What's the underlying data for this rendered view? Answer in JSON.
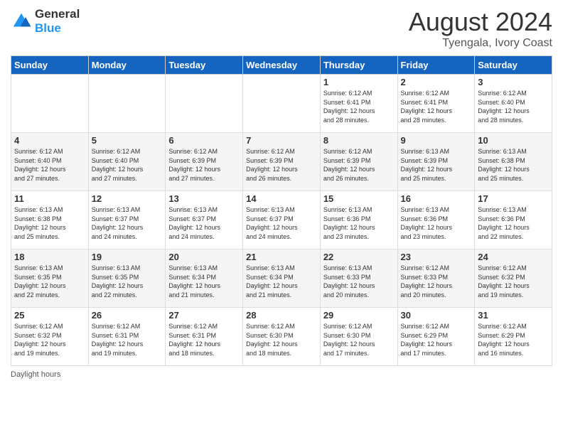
{
  "header": {
    "logo_general": "General",
    "logo_blue": "Blue",
    "title": "August 2024",
    "location": "Tyengala, Ivory Coast"
  },
  "weekdays": [
    "Sunday",
    "Monday",
    "Tuesday",
    "Wednesday",
    "Thursday",
    "Friday",
    "Saturday"
  ],
  "weeks": [
    [
      {
        "day": "",
        "info": ""
      },
      {
        "day": "",
        "info": ""
      },
      {
        "day": "",
        "info": ""
      },
      {
        "day": "",
        "info": ""
      },
      {
        "day": "1",
        "info": "Sunrise: 6:12 AM\nSunset: 6:41 PM\nDaylight: 12 hours\nand 28 minutes."
      },
      {
        "day": "2",
        "info": "Sunrise: 6:12 AM\nSunset: 6:41 PM\nDaylight: 12 hours\nand 28 minutes."
      },
      {
        "day": "3",
        "info": "Sunrise: 6:12 AM\nSunset: 6:40 PM\nDaylight: 12 hours\nand 28 minutes."
      }
    ],
    [
      {
        "day": "4",
        "info": "Sunrise: 6:12 AM\nSunset: 6:40 PM\nDaylight: 12 hours\nand 27 minutes."
      },
      {
        "day": "5",
        "info": "Sunrise: 6:12 AM\nSunset: 6:40 PM\nDaylight: 12 hours\nand 27 minutes."
      },
      {
        "day": "6",
        "info": "Sunrise: 6:12 AM\nSunset: 6:39 PM\nDaylight: 12 hours\nand 27 minutes."
      },
      {
        "day": "7",
        "info": "Sunrise: 6:12 AM\nSunset: 6:39 PM\nDaylight: 12 hours\nand 26 minutes."
      },
      {
        "day": "8",
        "info": "Sunrise: 6:12 AM\nSunset: 6:39 PM\nDaylight: 12 hours\nand 26 minutes."
      },
      {
        "day": "9",
        "info": "Sunrise: 6:13 AM\nSunset: 6:39 PM\nDaylight: 12 hours\nand 25 minutes."
      },
      {
        "day": "10",
        "info": "Sunrise: 6:13 AM\nSunset: 6:38 PM\nDaylight: 12 hours\nand 25 minutes."
      }
    ],
    [
      {
        "day": "11",
        "info": "Sunrise: 6:13 AM\nSunset: 6:38 PM\nDaylight: 12 hours\nand 25 minutes."
      },
      {
        "day": "12",
        "info": "Sunrise: 6:13 AM\nSunset: 6:37 PM\nDaylight: 12 hours\nand 24 minutes."
      },
      {
        "day": "13",
        "info": "Sunrise: 6:13 AM\nSunset: 6:37 PM\nDaylight: 12 hours\nand 24 minutes."
      },
      {
        "day": "14",
        "info": "Sunrise: 6:13 AM\nSunset: 6:37 PM\nDaylight: 12 hours\nand 24 minutes."
      },
      {
        "day": "15",
        "info": "Sunrise: 6:13 AM\nSunset: 6:36 PM\nDaylight: 12 hours\nand 23 minutes."
      },
      {
        "day": "16",
        "info": "Sunrise: 6:13 AM\nSunset: 6:36 PM\nDaylight: 12 hours\nand 23 minutes."
      },
      {
        "day": "17",
        "info": "Sunrise: 6:13 AM\nSunset: 6:36 PM\nDaylight: 12 hours\nand 22 minutes."
      }
    ],
    [
      {
        "day": "18",
        "info": "Sunrise: 6:13 AM\nSunset: 6:35 PM\nDaylight: 12 hours\nand 22 minutes."
      },
      {
        "day": "19",
        "info": "Sunrise: 6:13 AM\nSunset: 6:35 PM\nDaylight: 12 hours\nand 22 minutes."
      },
      {
        "day": "20",
        "info": "Sunrise: 6:13 AM\nSunset: 6:34 PM\nDaylight: 12 hours\nand 21 minutes."
      },
      {
        "day": "21",
        "info": "Sunrise: 6:13 AM\nSunset: 6:34 PM\nDaylight: 12 hours\nand 21 minutes."
      },
      {
        "day": "22",
        "info": "Sunrise: 6:13 AM\nSunset: 6:33 PM\nDaylight: 12 hours\nand 20 minutes."
      },
      {
        "day": "23",
        "info": "Sunrise: 6:12 AM\nSunset: 6:33 PM\nDaylight: 12 hours\nand 20 minutes."
      },
      {
        "day": "24",
        "info": "Sunrise: 6:12 AM\nSunset: 6:32 PM\nDaylight: 12 hours\nand 19 minutes."
      }
    ],
    [
      {
        "day": "25",
        "info": "Sunrise: 6:12 AM\nSunset: 6:32 PM\nDaylight: 12 hours\nand 19 minutes."
      },
      {
        "day": "26",
        "info": "Sunrise: 6:12 AM\nSunset: 6:31 PM\nDaylight: 12 hours\nand 19 minutes."
      },
      {
        "day": "27",
        "info": "Sunrise: 6:12 AM\nSunset: 6:31 PM\nDaylight: 12 hours\nand 18 minutes."
      },
      {
        "day": "28",
        "info": "Sunrise: 6:12 AM\nSunset: 6:30 PM\nDaylight: 12 hours\nand 18 minutes."
      },
      {
        "day": "29",
        "info": "Sunrise: 6:12 AM\nSunset: 6:30 PM\nDaylight: 12 hours\nand 17 minutes."
      },
      {
        "day": "30",
        "info": "Sunrise: 6:12 AM\nSunset: 6:29 PM\nDaylight: 12 hours\nand 17 minutes."
      },
      {
        "day": "31",
        "info": "Sunrise: 6:12 AM\nSunset: 6:29 PM\nDaylight: 12 hours\nand 16 minutes."
      }
    ]
  ],
  "footer": {
    "daylight_label": "Daylight hours"
  }
}
